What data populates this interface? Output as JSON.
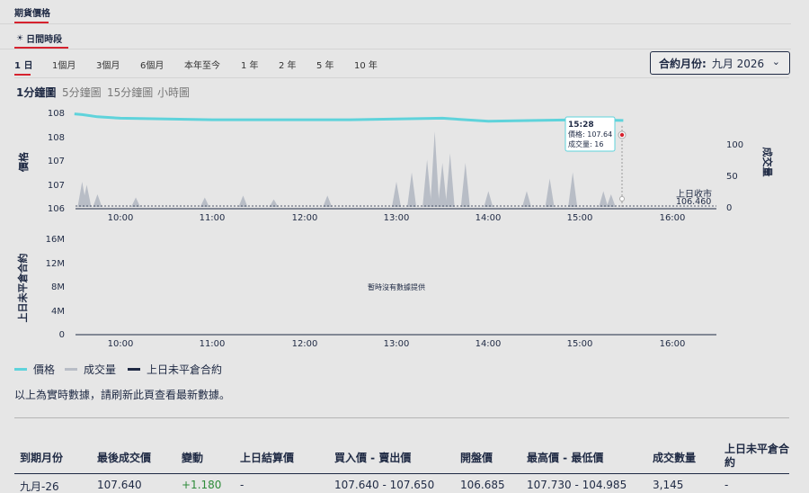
{
  "tabs": {
    "main": "期貨價格",
    "session": "日間時段",
    "session_icon": "☀"
  },
  "ranges": [
    "1 日",
    "1個月",
    "3個月",
    "6個月",
    "本年至今",
    "1 年",
    "2 年",
    "5 年",
    "10 年"
  ],
  "active_range": "1 日",
  "contract": {
    "label": "合約月份:",
    "value": "九月 2026",
    "icon": "chevron-down-icon"
  },
  "intervals": [
    "1分鐘圖",
    "5分鐘圖",
    "15分鐘圖",
    "小時圖"
  ],
  "active_interval": "1分鐘圖",
  "tooltip": {
    "time": "15:28",
    "price": "價格: 107.64",
    "volume": "成交量: 16"
  },
  "prev_close": {
    "label": "上日收市",
    "value": "106.460"
  },
  "no_data": "暫時沒有數據提供",
  "legend": [
    {
      "label": "價格",
      "color": "#5fd3db"
    },
    {
      "label": "成交量",
      "color": "#b8bdc6"
    },
    {
      "label": "上日未平倉合約",
      "color": "#1f2a44"
    }
  ],
  "note": "以上為實時數據，請刷新此頁查看最新數據。",
  "table": {
    "headers": [
      "到期月份",
      "最後成交價",
      "變動",
      "上日結算價",
      "買入價 - 賣出價",
      "開盤價",
      "最高價 - 最低價",
      "成交數量",
      "上日未平倉合約"
    ],
    "row": [
      "九月-26",
      "107.640",
      "+1.180",
      "-",
      "107.640 - 107.650",
      "106.685",
      "107.730 - 104.985",
      "3,145",
      "-"
    ],
    "change_color": "#2e8b3a"
  },
  "chart_data": [
    {
      "type": "line",
      "ylabel": "價格",
      "y2label": "成交量",
      "y_ticks": [
        "108",
        "108",
        "107",
        "107",
        "106"
      ],
      "y2_ticks": [
        "100",
        "50",
        "0"
      ],
      "x_ticks": [
        "10:00",
        "11:00",
        "12:00",
        "13:00",
        "14:00",
        "15:00",
        "16:00"
      ],
      "series": [
        {
          "name": "價格",
          "x": [
            "09:30",
            "09:35",
            "09:45",
            "10:00",
            "10:30",
            "11:00",
            "11:30",
            "12:00",
            "12:30",
            "13:00",
            "13:30",
            "13:45",
            "14:00",
            "14:30",
            "15:00",
            "15:28"
          ],
          "values": [
            107.73,
            107.72,
            107.69,
            107.67,
            107.66,
            107.65,
            107.65,
            107.65,
            107.65,
            107.66,
            107.67,
            107.65,
            107.63,
            107.64,
            107.65,
            107.64
          ]
        },
        {
          "name": "成交量",
          "x": [
            "09:35",
            "09:38",
            "09:45",
            "10:10",
            "10:55",
            "11:20",
            "11:40",
            "12:15",
            "13:00",
            "13:10",
            "13:20",
            "13:25",
            "13:30",
            "13:35",
            "13:45",
            "14:00",
            "14:25",
            "14:40",
            "14:55",
            "15:15",
            "15:20"
          ],
          "values": [
            40,
            35,
            20,
            15,
            15,
            18,
            12,
            18,
            40,
            55,
            75,
            120,
            70,
            85,
            70,
            25,
            25,
            45,
            55,
            25,
            20
          ]
        }
      ],
      "prev_close": 106.46
    },
    {
      "type": "line",
      "ylabel": "上日未平倉合約",
      "y_ticks": [
        "16M",
        "12M",
        "8M",
        "4M",
        "0"
      ],
      "x_ticks": [
        "10:00",
        "11:00",
        "12:00",
        "13:00",
        "14:00",
        "15:00",
        "16:00"
      ],
      "series": []
    }
  ]
}
